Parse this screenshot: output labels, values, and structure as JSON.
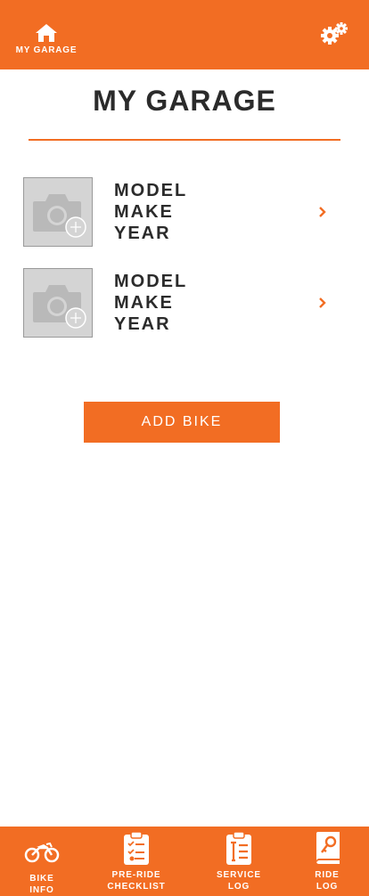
{
  "header": {
    "home_label": "MY GARAGE",
    "icons": {
      "home": "home-icon",
      "settings": "gears-icon"
    }
  },
  "page": {
    "title": "MY GARAGE"
  },
  "bikes": [
    {
      "model": "MODEL",
      "make": "MAKE",
      "year": "YEAR"
    },
    {
      "model": "MODEL",
      "make": "MAKE",
      "year": "YEAR"
    }
  ],
  "actions": {
    "add_bike": "ADD BIKE"
  },
  "bottom_nav": [
    {
      "line1": "BIKE",
      "line2": "INFO",
      "icon": "motorcycle-icon"
    },
    {
      "line1": "PRE-RIDE",
      "line2": "CHECKLIST",
      "icon": "checklist-icon"
    },
    {
      "line1": "SERVICE",
      "line2": "LOG",
      "icon": "service-clipboard-icon"
    },
    {
      "line1": "RIDE",
      "line2": "LOG",
      "icon": "ride-book-icon"
    }
  ],
  "colors": {
    "accent": "#f26d23",
    "text": "#2b2b2b",
    "photo_bg": "#d4d4d4",
    "white": "#ffffff"
  }
}
